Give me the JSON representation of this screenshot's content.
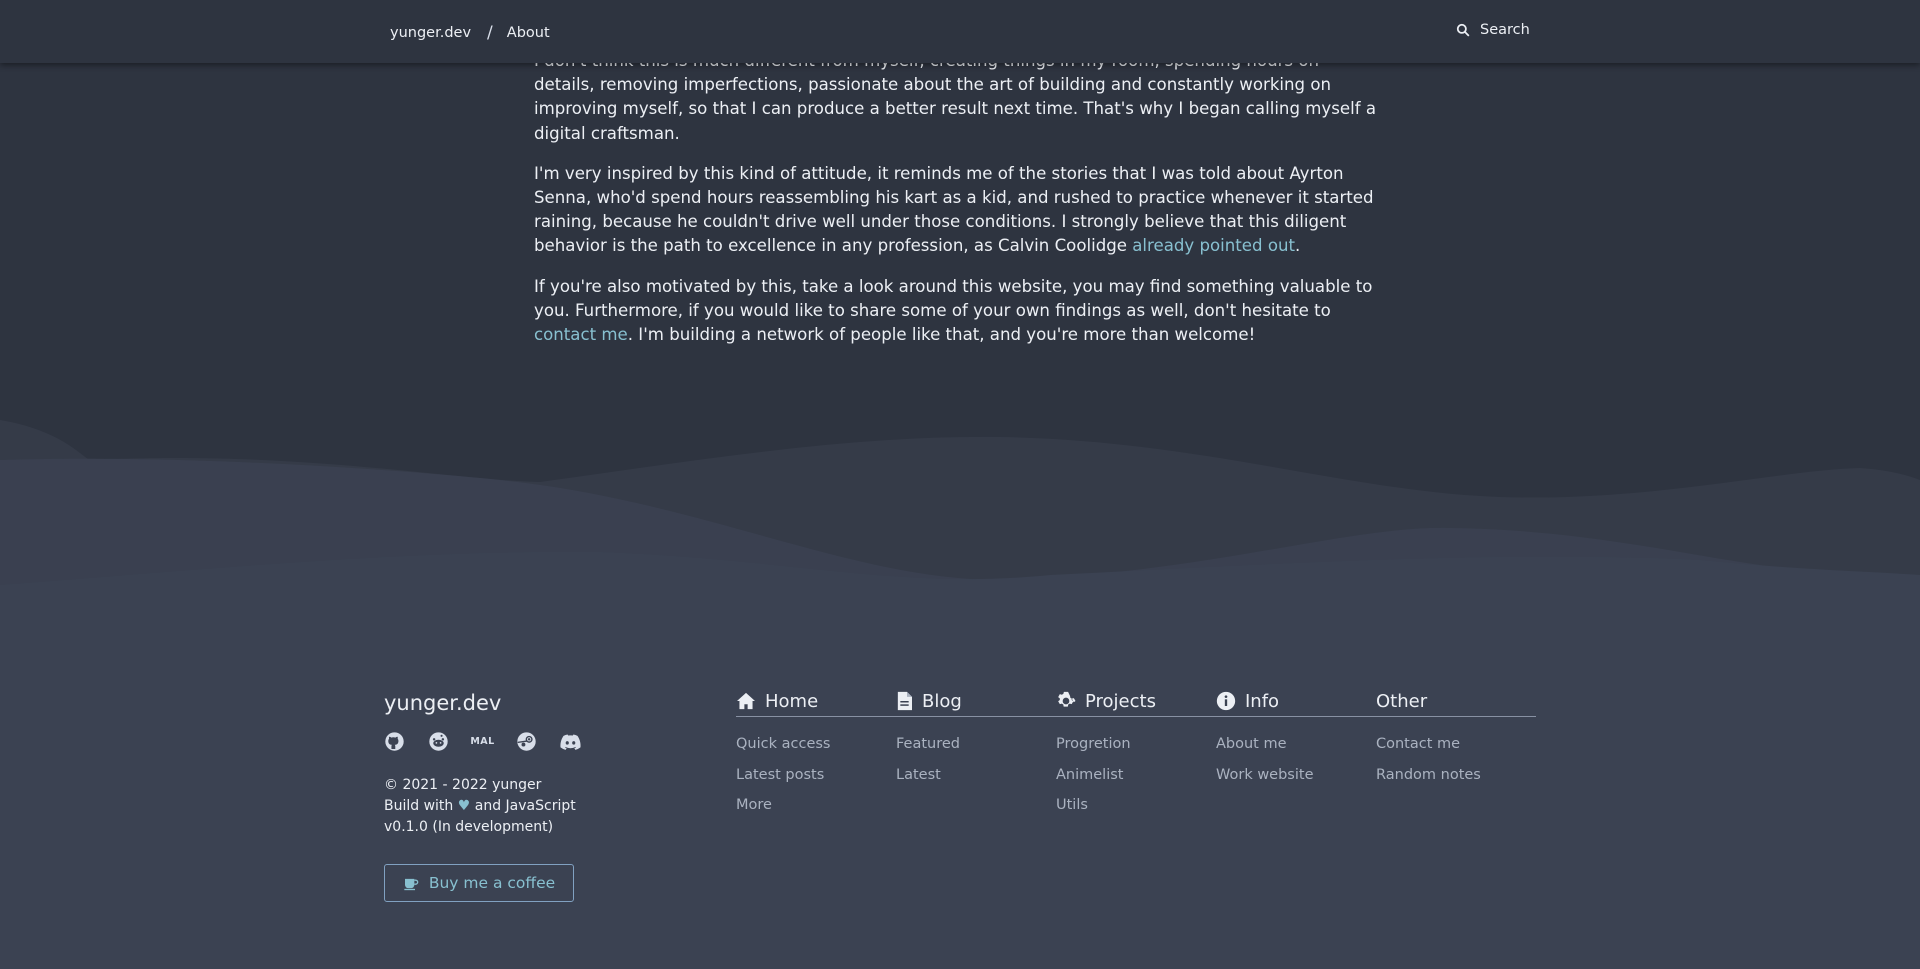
{
  "header": {
    "site": "yunger.dev",
    "separator": "/",
    "current": "About",
    "search_label": "Search"
  },
  "article": {
    "p1": "I don't think this is much different from myself, creating things in my room, spending hours on details, removing imperfections, passionate about the art of building and constantly working on improving myself, so that I can produce a better result next time. That's why I began calling myself a digital craftsman.",
    "p2_before": "I'm very inspired by this kind of attitude, it reminds me of the stories that I was told about Ayrton Senna, who'd spend hours reassembling his kart as a kid, and rushed to practice whenever it started raining, because he couldn't drive well under those conditions. I strongly believe that this diligent behavior is the path to excellence in any profession, as Calvin Coolidge ",
    "p2_link": "already pointed out",
    "p2_after": ".",
    "p3_before": "If you're also motivated by this, take a look around this website, you may find something valuable to you. Furthermore, if you would like to share some of your own findings as well, don't hesitate to ",
    "p3_link": "contact me",
    "p3_after": ". I'm building a network of people like that, and you're more than welcome!"
  },
  "footer": {
    "brand": "yunger.dev",
    "socials": [
      "github-icon",
      "reddit-icon",
      "MAL",
      "steam-icon",
      "discord-icon"
    ],
    "copyright": "© 2021 - 2022 yunger",
    "build_prefix": "Build with",
    "build_suffix": "and JavaScript",
    "version": "v0.1.0 (In development)",
    "coffee_label": "Buy me a coffee",
    "columns": [
      {
        "title": "Home",
        "icon": "home-icon",
        "links": [
          "Quick access",
          "Latest posts",
          "More"
        ]
      },
      {
        "title": "Blog",
        "icon": "document-icon",
        "links": [
          "Featured",
          "Latest"
        ]
      },
      {
        "title": "Projects",
        "icon": "gear-icon",
        "links": [
          "Progretion",
          "Animelist",
          "Utils"
        ]
      },
      {
        "title": "Info",
        "icon": "info-icon",
        "links": [
          "About me",
          "Work website"
        ]
      },
      {
        "title": "Other",
        "icon": "",
        "links": [
          "Contact me",
          "Random notes"
        ]
      }
    ]
  },
  "colors": {
    "background": "#2e3440",
    "footer": "#3b4252",
    "accent": "#88c0d0",
    "text": "#eceff4",
    "muted": "#aab2c0"
  }
}
